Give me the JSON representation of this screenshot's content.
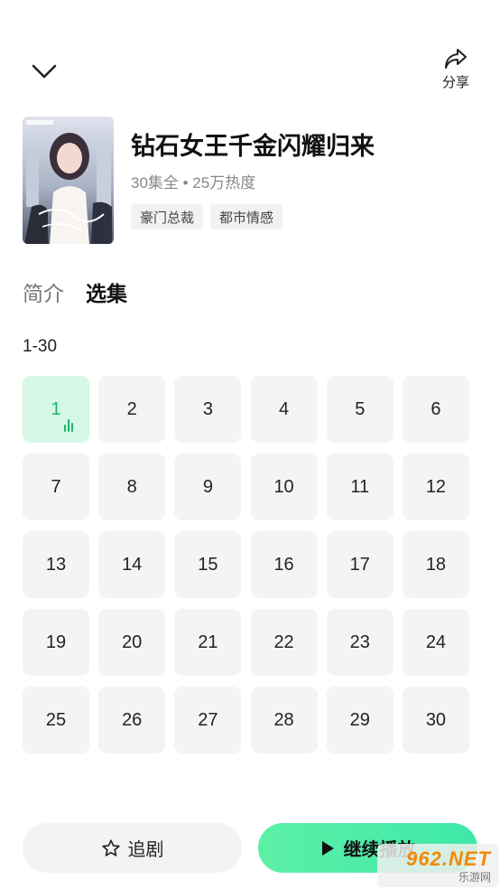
{
  "header": {
    "collapse_icon": "chevron-down-icon",
    "share_icon": "share-icon",
    "share_label": "分享"
  },
  "drama": {
    "title": "钻石女王千金闪耀归来",
    "meta": "30集全 • 25万热度",
    "tags": [
      "豪门总裁",
      "都市情感"
    ]
  },
  "tabs": [
    {
      "label": "简介",
      "active": false
    },
    {
      "label": "选集",
      "active": true
    }
  ],
  "episodes": {
    "range_label": "1-30",
    "current": 1,
    "items": [
      "1",
      "2",
      "3",
      "4",
      "5",
      "6",
      "7",
      "8",
      "9",
      "10",
      "11",
      "12",
      "13",
      "14",
      "15",
      "16",
      "17",
      "18",
      "19",
      "20",
      "21",
      "22",
      "23",
      "24",
      "25",
      "26",
      "27",
      "28",
      "29",
      "30"
    ]
  },
  "actions": {
    "follow_label": "追剧",
    "follow_icon": "star-icon",
    "play_label": "继续播放",
    "play_icon": "play-icon"
  },
  "watermark": {
    "main": "962.NET",
    "sub": "乐游网"
  },
  "colors": {
    "accent": "#1bb46a",
    "current_bg": "#d5f7e6",
    "play_button": "#5df0a7"
  }
}
